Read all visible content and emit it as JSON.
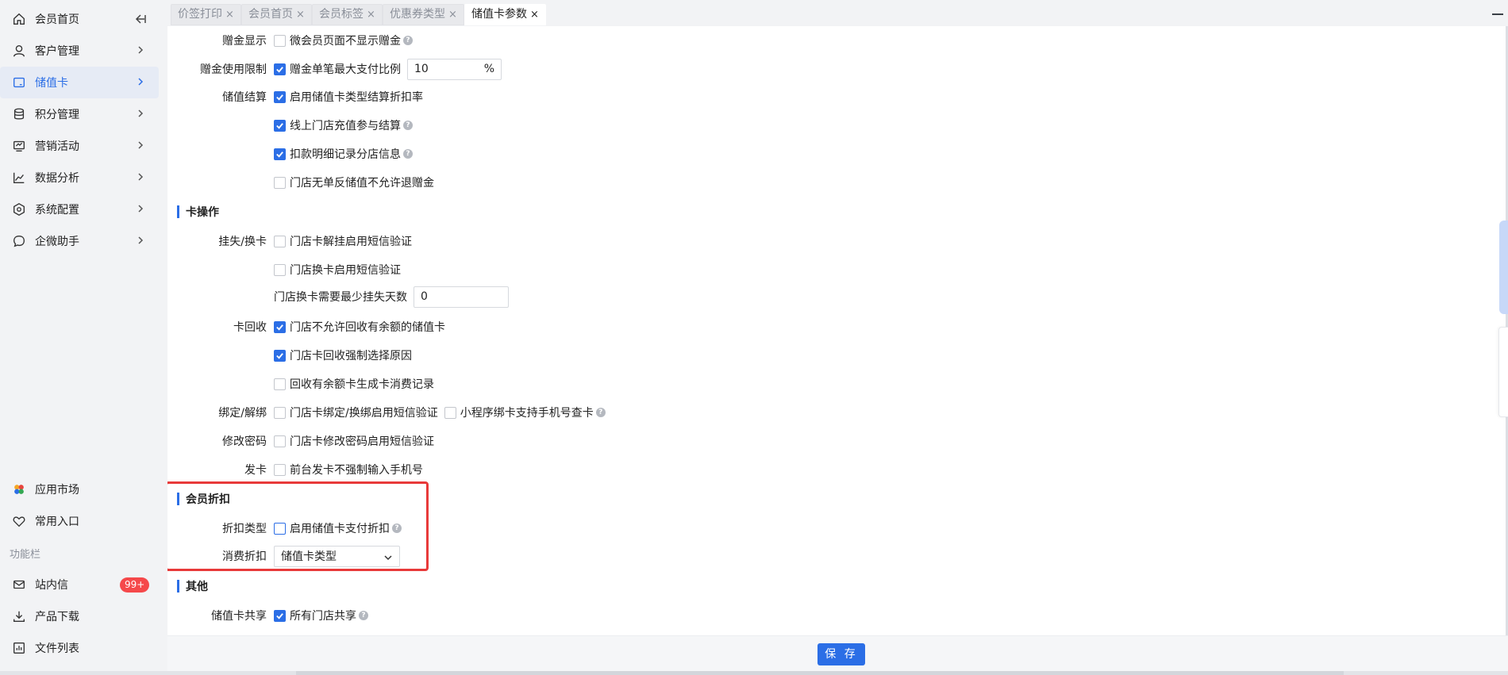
{
  "sidebar": {
    "top_items": [
      {
        "label": "会员首页",
        "icon": "home-icon"
      },
      {
        "label": "客户管理",
        "icon": "user-icon"
      },
      {
        "label": "储值卡",
        "icon": "card-icon"
      },
      {
        "label": "积分管理",
        "icon": "database-icon"
      },
      {
        "label": "营销活动",
        "icon": "monitor-icon"
      },
      {
        "label": "数据分析",
        "icon": "chart-line-icon"
      },
      {
        "label": "系统配置",
        "icon": "settings-icon"
      },
      {
        "label": "企微助手",
        "icon": "chat-icon"
      }
    ],
    "bottom_items": [
      {
        "label": "应用市场",
        "icon": "app-market-icon"
      },
      {
        "label": "常用入口",
        "icon": "heart-icon"
      }
    ],
    "section_label": "功能栏",
    "tool_items": [
      {
        "label": "站内信",
        "icon": "mail-icon",
        "badge": "99+"
      },
      {
        "label": "产品下载",
        "icon": "download-icon"
      },
      {
        "label": "文件列表",
        "icon": "file-list-icon"
      }
    ]
  },
  "tabs": [
    {
      "label": "价签打印",
      "close": "×"
    },
    {
      "label": "会员首页",
      "close": "×"
    },
    {
      "label": "会员标签",
      "close": "×"
    },
    {
      "label": "优惠券类型",
      "close": "×"
    },
    {
      "label": "储值卡参数",
      "close": "×"
    }
  ],
  "settings": {
    "gift_display": {
      "label": "赠金显示",
      "option": "微会员页面不显示赠金"
    },
    "gift_limit": {
      "label": "赠金使用限制",
      "option": "赠金单笔最大支付比例",
      "value": "10",
      "suffix": "%"
    },
    "settlement": {
      "label": "储值结算",
      "options": [
        "启用储值卡类型结算折扣率",
        "线上门店充值参与结算",
        "扣款明细记录分店信息",
        "门店无单反储值不允许退赠金"
      ]
    },
    "card_ops_title": "卡操作",
    "loss": {
      "label": "挂失/换卡",
      "options": [
        "门店卡解挂启用短信验证",
        "门店换卡启用短信验证"
      ],
      "days_label": "门店换卡需要最少挂失天数",
      "days_value": "0"
    },
    "recycle": {
      "label": "卡回收",
      "options": [
        "门店不允许回收有余额的储值卡",
        "门店卡回收强制选择原因",
        "回收有余额卡生成卡消费记录"
      ]
    },
    "bind": {
      "label": "绑定/解绑",
      "option1": "门店卡绑定/换绑启用短信验证",
      "option2": "小程序绑卡支持手机号查卡"
    },
    "password": {
      "label": "修改密码",
      "option": "门店卡修改密码启用短信验证"
    },
    "issue": {
      "label": "发卡",
      "option": "前台发卡不强制输入手机号"
    },
    "discount_title": "会员折扣",
    "discount_type": {
      "label": "折扣类型",
      "option": "启用储值卡支付折扣"
    },
    "consume_discount": {
      "label": "消费折扣",
      "selected": "储值卡类型"
    },
    "other_title": "其他",
    "share": {
      "label": "储值卡共享",
      "option": "所有门店共享"
    }
  },
  "help_glyph": "?",
  "footer": {
    "save_label": "保 存"
  },
  "colors": {
    "accent": "#2b6ee6",
    "highlight": "#e83a3a",
    "badge": "#f5484a"
  }
}
